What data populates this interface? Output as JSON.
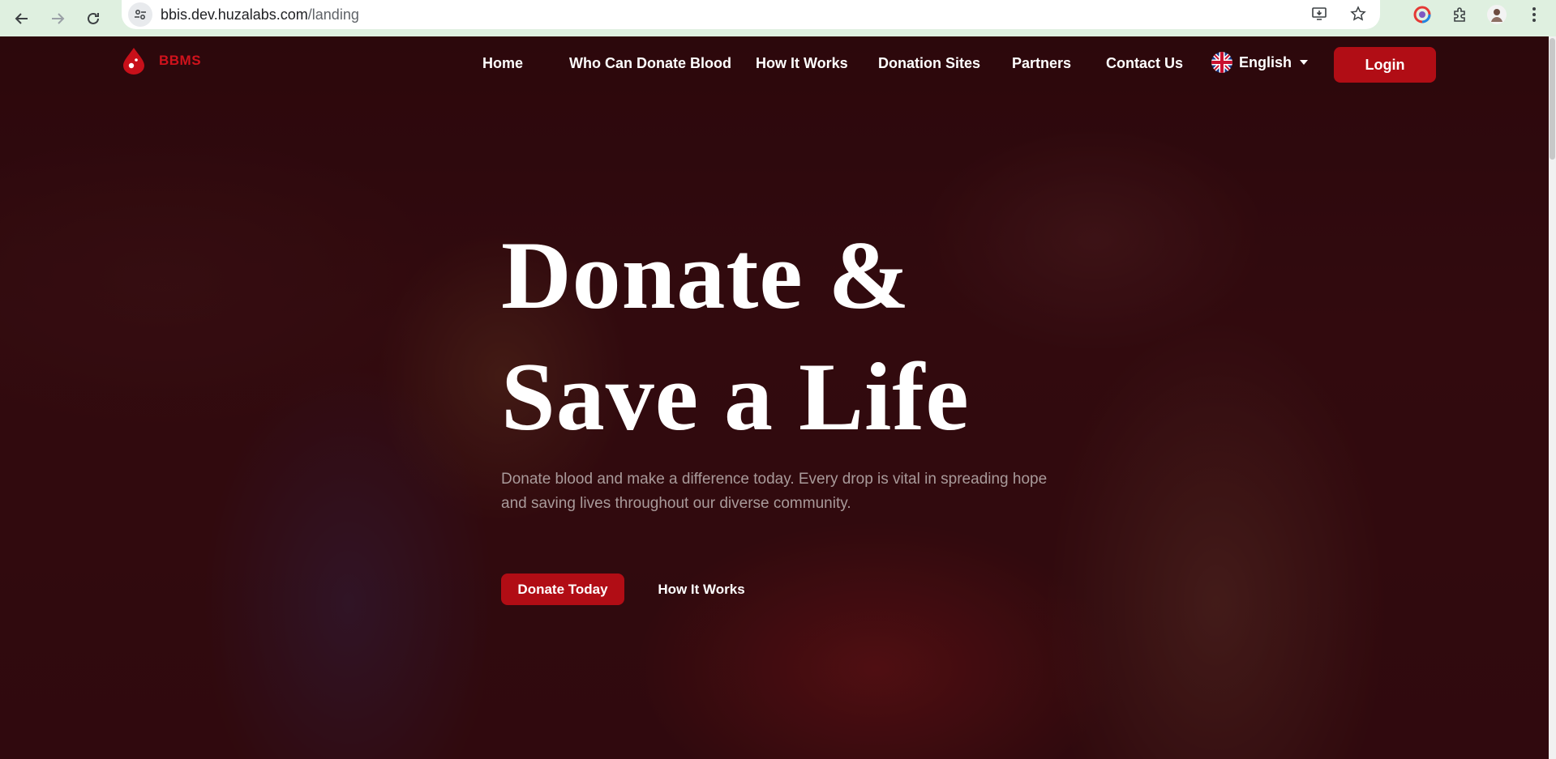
{
  "browser": {
    "url_host": "bbis.dev.huzalabs.com",
    "url_path": "/landing"
  },
  "site": {
    "brand": "BBMS",
    "nav": [
      {
        "label": "Home"
      },
      {
        "label": "Who Can Donate Blood"
      },
      {
        "label": "How It Works"
      },
      {
        "label": "Donation Sites"
      },
      {
        "label": "Partners"
      },
      {
        "label": "Contact Us"
      }
    ],
    "language": "English",
    "login_label": "Login"
  },
  "hero": {
    "title_line1": "Donate &",
    "title_line2": "Save a Life",
    "subtitle": "Donate blood and make a difference today. Every drop is vital in spreading hope and saving lives throughout our diverse community.",
    "cta_primary": "Donate Today",
    "cta_secondary": "How It Works"
  },
  "colors": {
    "brand_red": "#b10d15",
    "brand_text_red": "#d0121c",
    "overlay": "#2b0a0d"
  }
}
